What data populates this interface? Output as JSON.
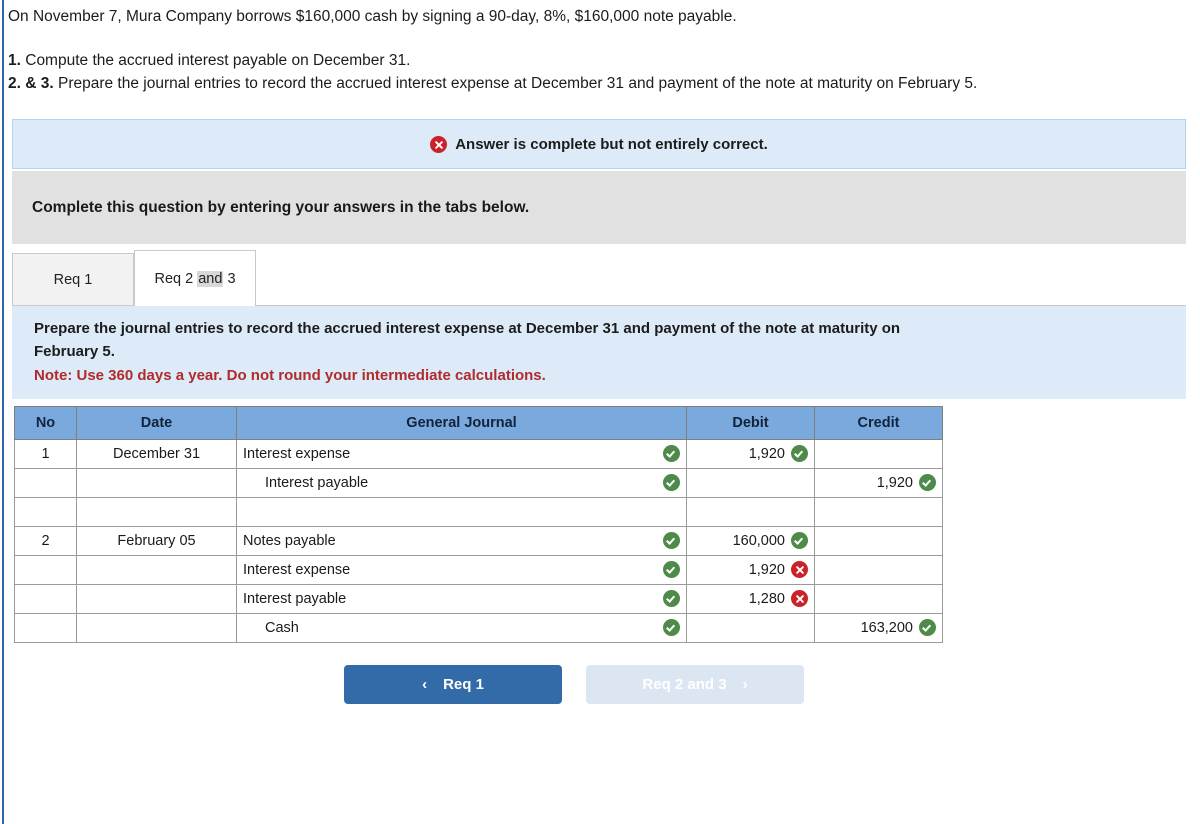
{
  "problem": {
    "statement": "On November 7, Mura Company borrows $160,000 cash by signing a 90-day, 8%, $160,000 note payable.",
    "req1_num": "1.",
    "req1_text": " Compute the accrued interest payable on December 31.",
    "req23_num": "2. & 3.",
    "req23_text": " Prepare the journal entries to record the accrued interest expense at December 31 and payment of the note at maturity on February 5."
  },
  "alert": {
    "icon": "x-circle-icon",
    "message": "Answer is complete but not entirely correct.",
    "bg_color": "#dcebf7",
    "icon_color": "#c9222b"
  },
  "instruction": {
    "text": "Complete this question by entering your answers in the tabs below.",
    "bg_color": "#e1e1e1"
  },
  "tabs": [
    {
      "label": "Req 1",
      "active": false
    },
    {
      "label_pre": "Req 2 ",
      "label_hl": "and",
      "label_post": " 3",
      "active": true
    }
  ],
  "requirement": {
    "line1": "Prepare the journal entries to record the accrued interest expense at December 31 and payment of the note at maturity on",
    "line2": "February 5.",
    "note": "Note: Use 360 days a year. Do not round your intermediate calculations.",
    "bg_color": "#dcebf7",
    "note_color": "#b02b2b"
  },
  "table": {
    "headers": [
      "No",
      "Date",
      "General Journal",
      "Debit",
      "Credit"
    ],
    "header_bg": "#7aa9dd",
    "rows": [
      {
        "no": "1",
        "date": "December 31",
        "account": "Interest expense",
        "indent": false,
        "account_status": "check",
        "debit": "1,920",
        "debit_status": "check",
        "credit": "",
        "credit_status": ""
      },
      {
        "no": "",
        "date": "",
        "account": "Interest payable",
        "indent": true,
        "account_status": "check",
        "debit": "",
        "debit_status": "",
        "credit": "1,920",
        "credit_status": "check"
      },
      {
        "no": "",
        "date": "",
        "account": "",
        "indent": false,
        "account_status": "",
        "debit": "",
        "debit_status": "",
        "credit": "",
        "credit_status": "",
        "blank": true
      },
      {
        "no": "2",
        "date": "February 05",
        "account": "Notes payable",
        "indent": false,
        "account_status": "check",
        "debit": "160,000",
        "debit_status": "check",
        "credit": "",
        "credit_status": ""
      },
      {
        "no": "",
        "date": "",
        "account": "Interest expense",
        "indent": false,
        "account_status": "check",
        "debit": "1,920",
        "debit_status": "x",
        "credit": "",
        "credit_status": ""
      },
      {
        "no": "",
        "date": "",
        "account": "Interest payable",
        "indent": false,
        "account_status": "check",
        "debit": "1,280",
        "debit_status": "x",
        "credit": "",
        "credit_status": ""
      },
      {
        "no": "",
        "date": "",
        "account": "Cash",
        "indent": true,
        "account_status": "check",
        "debit": "",
        "debit_status": "",
        "credit": "163,200",
        "credit_status": "check"
      }
    ]
  },
  "nav": {
    "prev_label": "Req 1",
    "prev_chevron": "‹",
    "next_label": "Req 2 and 3",
    "next_chevron": "›",
    "prev_color": "#336ba8",
    "next_color": "#dbe6f2"
  }
}
